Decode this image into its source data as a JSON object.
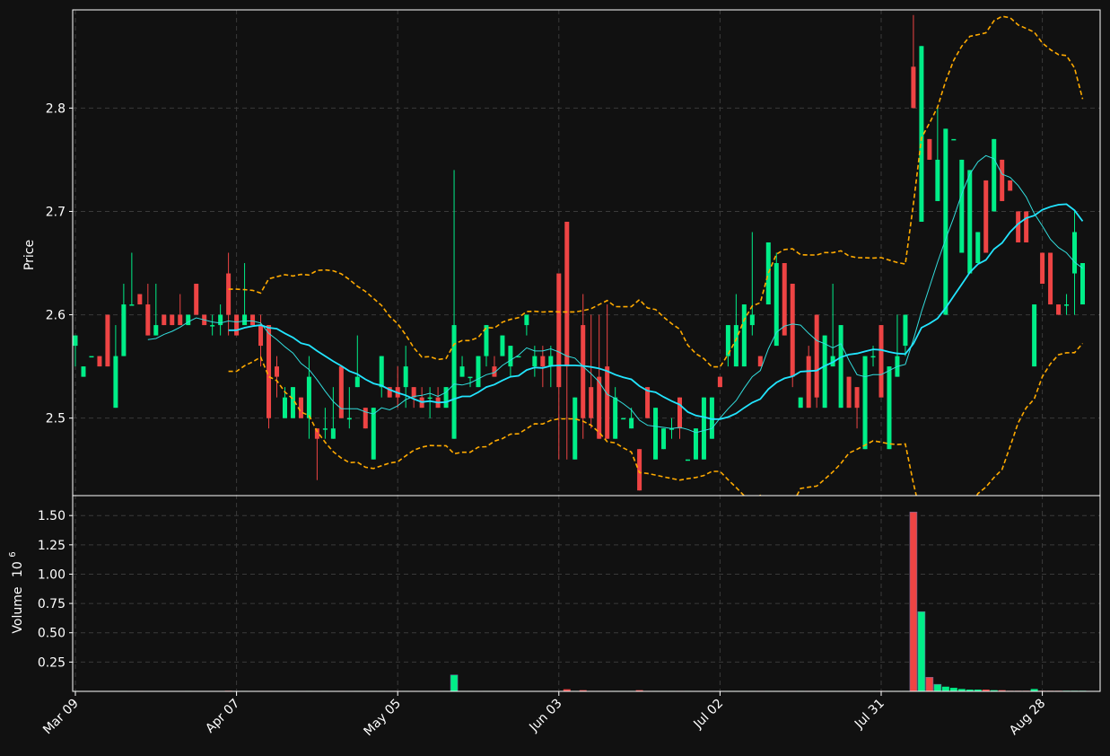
{
  "colors": {
    "background": "#111111",
    "up": "#00ee88",
    "down": "#ee4444",
    "grid": "#3a3a3a",
    "axis": "#ffffff",
    "ma_fast": "#33dddd",
    "ma_slow": "#22e5ff",
    "bollinger": "#ffaa00"
  },
  "chart_data": {
    "type": "candlestick",
    "panels": [
      "price",
      "volume"
    ],
    "ylabel_price": "Price",
    "ylabel_volume": "Volume",
    "ylabel_volume_exp": "10",
    "ylabel_volume_pow": "6",
    "ylim_price": [
      2.425,
      2.895
    ],
    "ylim_volume": [
      0,
      1.67
    ],
    "price_ticks": [
      "2.5",
      "2.6",
      "2.7",
      "2.8"
    ],
    "price_tick_values": [
      2.5,
      2.6,
      2.7,
      2.8
    ],
    "volume_ticks": [
      "0.25",
      "0.50",
      "0.75",
      "1.00",
      "1.25",
      "1.50"
    ],
    "volume_tick_values": [
      0.25,
      0.5,
      0.75,
      1.0,
      1.25,
      1.5
    ],
    "x_ticks": [
      "Mar 09",
      "Apr 07",
      "May 05",
      "Jun 03",
      "Jul 02",
      "Jul 31",
      "Aug 28"
    ],
    "x_tick_index": [
      0,
      20,
      40,
      60,
      80,
      100,
      120
    ],
    "grid": true,
    "ohlc": [
      [
        2.57,
        2.58,
        2.55,
        2.58
      ],
      [
        2.54,
        2.55,
        2.54,
        2.55
      ],
      [
        2.56,
        2.56,
        2.56,
        2.56
      ],
      [
        2.56,
        2.56,
        2.55,
        2.55
      ],
      [
        2.6,
        2.6,
        2.55,
        2.55
      ],
      [
        2.51,
        2.59,
        2.51,
        2.56
      ],
      [
        2.56,
        2.63,
        2.56,
        2.61
      ],
      [
        2.61,
        2.66,
        2.61,
        2.61
      ],
      [
        2.62,
        2.62,
        2.61,
        2.61
      ],
      [
        2.61,
        2.63,
        2.58,
        2.58
      ],
      [
        2.58,
        2.63,
        2.58,
        2.59
      ],
      [
        2.6,
        2.6,
        2.59,
        2.59
      ],
      [
        2.6,
        2.6,
        2.59,
        2.59
      ],
      [
        2.6,
        2.62,
        2.59,
        2.59
      ],
      [
        2.59,
        2.6,
        2.59,
        2.6
      ],
      [
        2.63,
        2.63,
        2.6,
        2.6
      ],
      [
        2.6,
        2.6,
        2.59,
        2.59
      ],
      [
        2.59,
        2.6,
        2.58,
        2.59
      ],
      [
        2.59,
        2.61,
        2.58,
        2.6
      ],
      [
        2.64,
        2.66,
        2.58,
        2.6
      ],
      [
        2.6,
        2.6,
        2.58,
        2.58
      ],
      [
        2.59,
        2.65,
        2.59,
        2.6
      ],
      [
        2.6,
        2.6,
        2.59,
        2.59
      ],
      [
        2.59,
        2.6,
        2.55,
        2.57
      ],
      [
        2.59,
        2.59,
        2.49,
        2.5
      ],
      [
        2.55,
        2.56,
        2.52,
        2.54
      ],
      [
        2.5,
        2.53,
        2.5,
        2.52
      ],
      [
        2.5,
        2.53,
        2.5,
        2.53
      ],
      [
        2.52,
        2.52,
        2.5,
        2.5
      ],
      [
        2.5,
        2.56,
        2.48,
        2.54
      ],
      [
        2.49,
        2.49,
        2.44,
        2.48
      ],
      [
        2.49,
        2.51,
        2.48,
        2.49
      ],
      [
        2.48,
        2.53,
        2.48,
        2.49
      ],
      [
        2.55,
        2.55,
        2.5,
        2.5
      ],
      [
        2.5,
        2.53,
        2.49,
        2.5
      ],
      [
        2.53,
        2.58,
        2.53,
        2.54
      ],
      [
        2.51,
        2.51,
        2.49,
        2.49
      ],
      [
        2.46,
        2.51,
        2.46,
        2.51
      ],
      [
        2.53,
        2.56,
        2.52,
        2.56
      ],
      [
        2.53,
        2.53,
        2.52,
        2.52
      ],
      [
        2.53,
        2.55,
        2.51,
        2.52
      ],
      [
        2.53,
        2.57,
        2.51,
        2.55
      ],
      [
        2.53,
        2.53,
        2.51,
        2.52
      ],
      [
        2.52,
        2.53,
        2.51,
        2.51
      ],
      [
        2.52,
        2.53,
        2.5,
        2.52
      ],
      [
        2.52,
        2.53,
        2.51,
        2.51
      ],
      [
        2.51,
        2.53,
        2.51,
        2.53
      ],
      [
        2.48,
        2.74,
        2.48,
        2.59
      ],
      [
        2.54,
        2.56,
        2.54,
        2.55
      ],
      [
        2.54,
        2.54,
        2.53,
        2.54
      ],
      [
        2.53,
        2.56,
        2.53,
        2.56
      ],
      [
        2.56,
        2.59,
        2.55,
        2.59
      ],
      [
        2.55,
        2.56,
        2.54,
        2.54
      ],
      [
        2.56,
        2.58,
        2.56,
        2.58
      ],
      [
        2.55,
        2.57,
        2.54,
        2.57
      ],
      [
        2.56,
        2.56,
        2.56,
        2.56
      ],
      [
        2.59,
        2.6,
        2.58,
        2.6
      ],
      [
        2.55,
        2.57,
        2.54,
        2.56
      ],
      [
        2.56,
        2.57,
        2.53,
        2.55
      ],
      [
        2.55,
        2.57,
        2.53,
        2.56
      ],
      [
        2.64,
        2.64,
        2.46,
        2.53
      ],
      [
        2.69,
        2.69,
        2.46,
        2.55
      ],
      [
        2.46,
        2.52,
        2.46,
        2.52
      ],
      [
        2.59,
        2.62,
        2.48,
        2.5
      ],
      [
        2.53,
        2.6,
        2.49,
        2.5
      ],
      [
        2.54,
        2.6,
        2.48,
        2.48
      ],
      [
        2.55,
        2.61,
        2.48,
        2.48
      ],
      [
        2.48,
        2.53,
        2.48,
        2.52
      ],
      [
        2.5,
        2.5,
        2.5,
        2.5
      ],
      [
        2.49,
        2.51,
        2.49,
        2.5
      ],
      [
        2.47,
        2.47,
        2.43,
        2.43
      ],
      [
        2.53,
        2.53,
        2.5,
        2.5
      ],
      [
        2.46,
        2.51,
        2.46,
        2.51
      ],
      [
        2.47,
        2.49,
        2.47,
        2.49
      ],
      [
        2.49,
        2.5,
        2.48,
        2.49
      ],
      [
        2.52,
        2.52,
        2.48,
        2.49
      ],
      [
        2.46,
        2.46,
        2.46,
        2.46
      ],
      [
        2.46,
        2.49,
        2.46,
        2.49
      ],
      [
        2.46,
        2.52,
        2.46,
        2.52
      ],
      [
        2.48,
        2.52,
        2.48,
        2.52
      ],
      [
        2.54,
        2.54,
        2.53,
        2.53
      ],
      [
        2.56,
        2.59,
        2.55,
        2.59
      ],
      [
        2.55,
        2.62,
        2.55,
        2.59
      ],
      [
        2.55,
        2.61,
        2.55,
        2.61
      ],
      [
        2.59,
        2.68,
        2.58,
        2.6
      ],
      [
        2.56,
        2.56,
        2.55,
        2.55
      ],
      [
        2.61,
        2.67,
        2.61,
        2.67
      ],
      [
        2.57,
        2.66,
        2.57,
        2.65
      ],
      [
        2.65,
        2.65,
        2.58,
        2.58
      ],
      [
        2.63,
        2.63,
        2.53,
        2.54
      ],
      [
        2.51,
        2.52,
        2.51,
        2.52
      ],
      [
        2.56,
        2.57,
        2.51,
        2.51
      ],
      [
        2.6,
        2.6,
        2.51,
        2.52
      ],
      [
        2.51,
        2.58,
        2.51,
        2.58
      ],
      [
        2.55,
        2.63,
        2.55,
        2.56
      ],
      [
        2.51,
        2.59,
        2.51,
        2.59
      ],
      [
        2.54,
        2.54,
        2.51,
        2.51
      ],
      [
        2.53,
        2.53,
        2.49,
        2.51
      ],
      [
        2.47,
        2.56,
        2.47,
        2.56
      ],
      [
        2.56,
        2.57,
        2.55,
        2.56
      ],
      [
        2.59,
        2.59,
        2.52,
        2.52
      ],
      [
        2.47,
        2.55,
        2.47,
        2.55
      ],
      [
        2.54,
        2.6,
        2.54,
        2.56
      ],
      [
        2.57,
        2.57,
        2.56,
        2.6
      ],
      [
        2.84,
        2.89,
        2.8,
        2.8
      ],
      [
        2.69,
        2.86,
        2.69,
        2.86
      ],
      [
        2.77,
        2.77,
        2.75,
        2.75
      ],
      [
        2.71,
        2.8,
        2.71,
        2.75
      ],
      [
        2.6,
        2.78,
        2.6,
        2.78
      ],
      [
        2.77,
        2.77,
        2.77,
        2.77
      ],
      [
        2.66,
        2.75,
        2.66,
        2.75
      ],
      [
        2.64,
        2.74,
        2.64,
        2.74
      ],
      [
        2.65,
        2.68,
        2.65,
        2.68
      ],
      [
        2.73,
        2.73,
        2.66,
        2.66
      ],
      [
        2.7,
        2.77,
        2.7,
        2.77
      ],
      [
        2.75,
        2.75,
        2.71,
        2.71
      ],
      [
        2.73,
        2.73,
        2.72,
        2.72
      ],
      [
        2.7,
        2.7,
        2.67,
        2.67
      ],
      [
        2.7,
        2.7,
        2.67,
        2.67
      ],
      [
        2.55,
        2.61,
        2.55,
        2.61
      ],
      [
        2.66,
        2.66,
        2.63,
        2.63
      ],
      [
        2.66,
        2.66,
        2.61,
        2.61
      ],
      [
        2.61,
        2.61,
        2.6,
        2.6
      ],
      [
        2.61,
        2.62,
        2.6,
        2.61
      ],
      [
        2.64,
        2.7,
        2.6,
        2.68
      ],
      [
        2.61,
        2.65,
        2.61,
        2.65
      ]
    ],
    "volume": [
      0.004,
      0.002,
      0.003,
      0.003,
      0.002,
      0.003,
      0.004,
      0.003,
      0.004,
      0.002,
      0.003,
      0.003,
      0.002,
      0.002,
      0.004,
      0.003,
      0.003,
      0.002,
      0.003,
      0.005,
      0.003,
      0.004,
      0.003,
      0.004,
      0.004,
      0.003,
      0.003,
      0.004,
      0.003,
      0.004,
      0.003,
      0.004,
      0.003,
      0.004,
      0.003,
      0.004,
      0.003,
      0.004,
      0.004,
      0.003,
      0.004,
      0.004,
      0.004,
      0.003,
      0.003,
      0.004,
      0.004,
      0.14,
      0.004,
      0.004,
      0.003,
      0.004,
      0.003,
      0.003,
      0.003,
      0.003,
      0.003,
      0.003,
      0.003,
      0.003,
      0.004,
      0.018,
      0.004,
      0.01,
      0.004,
      0.004,
      0.004,
      0.004,
      0.004,
      0.004,
      0.01,
      0.004,
      0.004,
      0.004,
      0.004,
      0.004,
      0.004,
      0.003,
      0.003,
      0.003,
      0.003,
      0.004,
      0.004,
      0.004,
      0.004,
      0.004,
      0.004,
      0.004,
      0.004,
      0.004,
      0.004,
      0.004,
      0.004,
      0.004,
      0.004,
      0.004,
      0.004,
      0.004,
      0.004,
      0.004,
      0.004,
      0.004,
      0.004,
      0.004,
      1.53,
      0.68,
      0.12,
      0.06,
      0.04,
      0.03,
      0.02,
      0.015,
      0.015,
      0.015,
      0.01,
      0.01,
      0.005,
      0.005,
      0.005,
      0.02,
      0.005,
      0.005,
      0.005,
      0.005,
      0.005,
      0.005
    ]
  }
}
